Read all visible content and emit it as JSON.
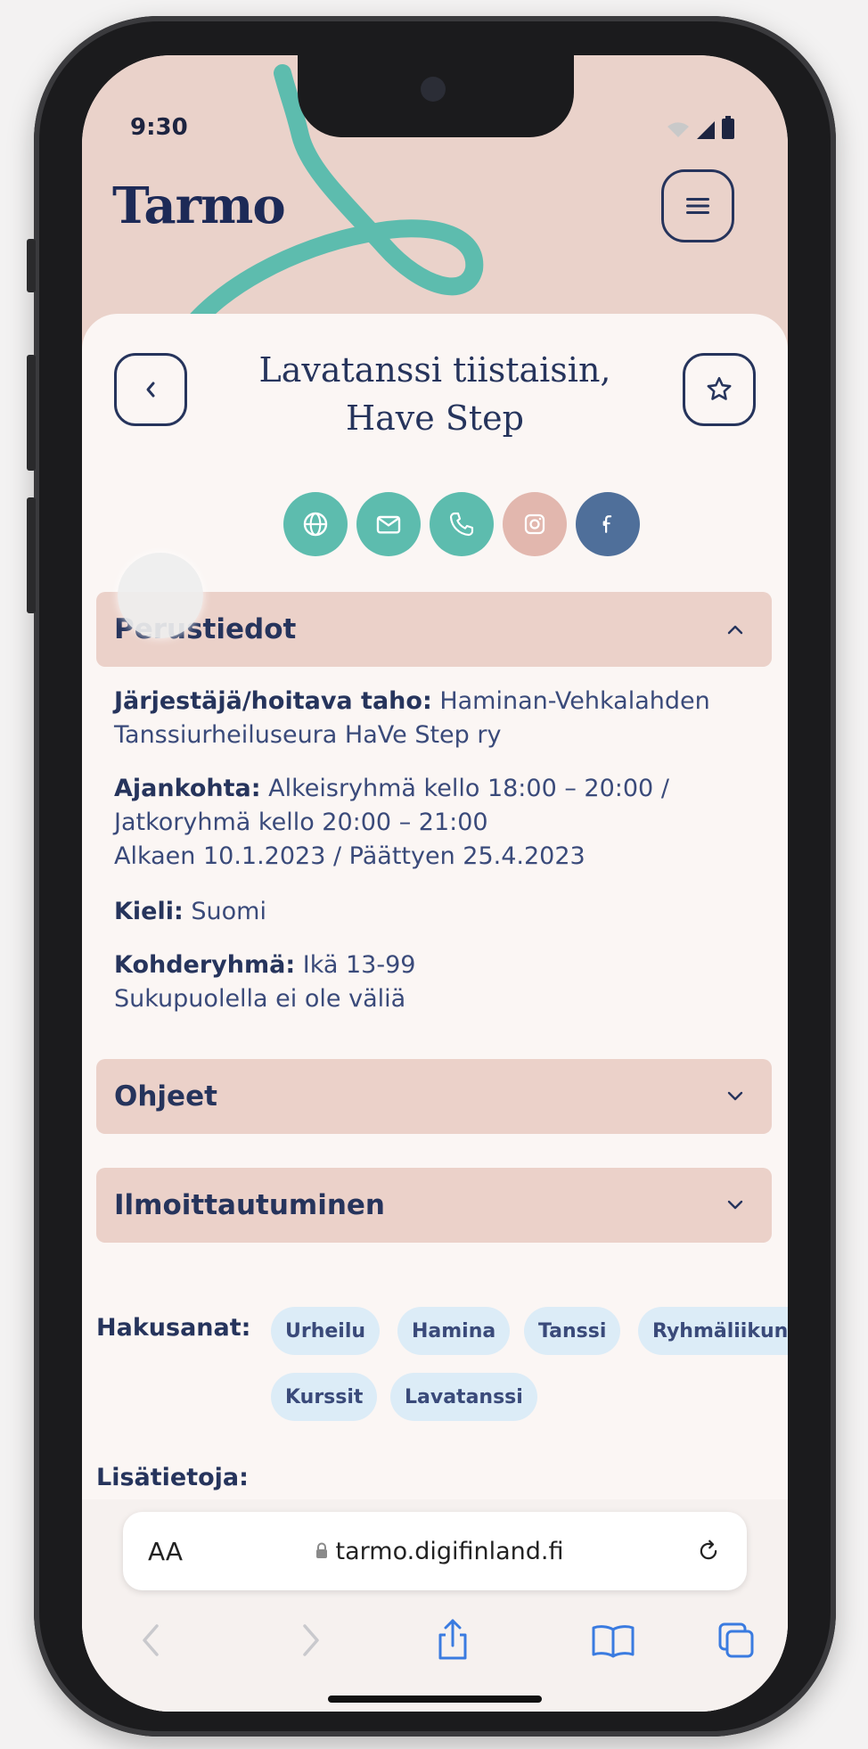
{
  "status": {
    "time": "9:30"
  },
  "header": {
    "logo": "Tarmo"
  },
  "event": {
    "title_line1": "Lavatanssi tiistaisin,",
    "title_line2": "Have Step"
  },
  "colors": {
    "hero": "#ead2ca",
    "swirl": "#5dbcae",
    "navy": "#26345c",
    "social_teal": "#5dbcae",
    "social_pink": "#e2b7ae",
    "social_blue": "#4f6f9a",
    "chip": "#dcecf7"
  },
  "socials": [
    {
      "icon": "globe-icon"
    },
    {
      "icon": "mail-icon"
    },
    {
      "icon": "phone-icon"
    },
    {
      "icon": "instagram-icon"
    },
    {
      "icon": "facebook-icon"
    }
  ],
  "sections": {
    "basic": {
      "title": "Perustiedot",
      "organizer_label": "Järjestäjä/hoitava taho:",
      "organizer_value": " Haminan-Vehkalahden",
      "organizer_value2": "Tanssiurheiluseura HaVe Step ry",
      "time_label": "Ajankohta:",
      "time_value": " Alkeisryhmä kello 18:00 – 20:00 /",
      "time_value2": "Jatkoryhmä kello 20:00 – 21:00",
      "time_value3": "Alkaen 10.1.2023 / Päättyen 25.4.2023",
      "language_label": "Kieli:",
      "language_value": " Suomi",
      "target_label": "Kohderyhmä:",
      "target_value": " Ikä 13-99",
      "target_value2": "Sukupuolella ei ole väliä"
    },
    "instructions": {
      "title": "Ohjeet"
    },
    "registration": {
      "title": "Ilmoittautuminen"
    }
  },
  "keywords": {
    "label": "Hakusanat:",
    "items": [
      "Urheilu",
      "Hamina",
      "Tanssi",
      "Ryhmäliikunta",
      "Kurssit",
      "Lavatanssi"
    ]
  },
  "more_info": {
    "label": "Lisätietoja:"
  },
  "browser": {
    "text_size": "AA",
    "url": "tarmo.digifinland.fi"
  }
}
